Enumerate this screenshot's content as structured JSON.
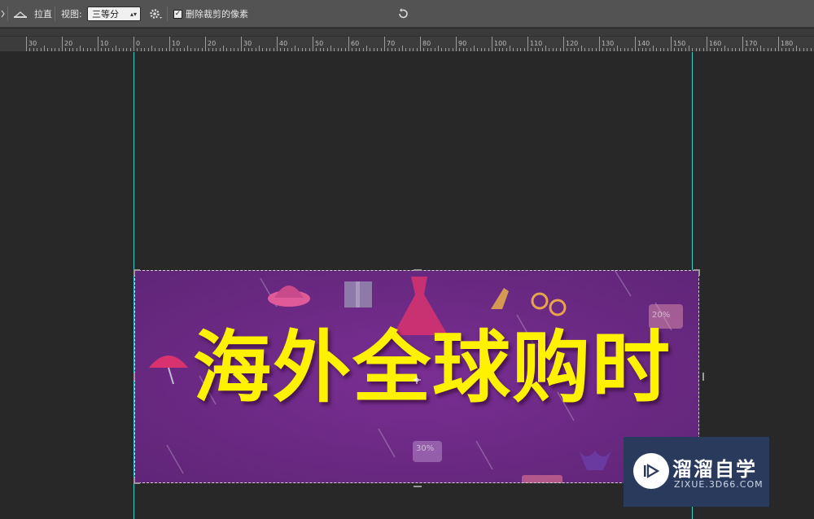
{
  "options_bar": {
    "straighten_label": "拉直",
    "view_label": "视图:",
    "view_select_value": "三等分",
    "delete_cropped_label": "删除裁剪的像素",
    "delete_cropped_checked": true
  },
  "ruler": {
    "ticks": [
      "30",
      "20",
      "10",
      "0",
      "10",
      "20",
      "30",
      "40",
      "50",
      "60",
      "70",
      "80",
      "90",
      "100",
      "110",
      "120",
      "130",
      "140",
      "150",
      "160",
      "170",
      "180"
    ]
  },
  "canvas": {
    "banner_title": "海外全球购时",
    "stickers": [
      "20%",
      "30%"
    ],
    "colors": {
      "background": "#6e2a86",
      "title": "#fff200",
      "guide": "#3ad1c8"
    }
  },
  "watermark": {
    "title": "溜溜自学",
    "url": "ZIXUE.3D66.COM"
  }
}
